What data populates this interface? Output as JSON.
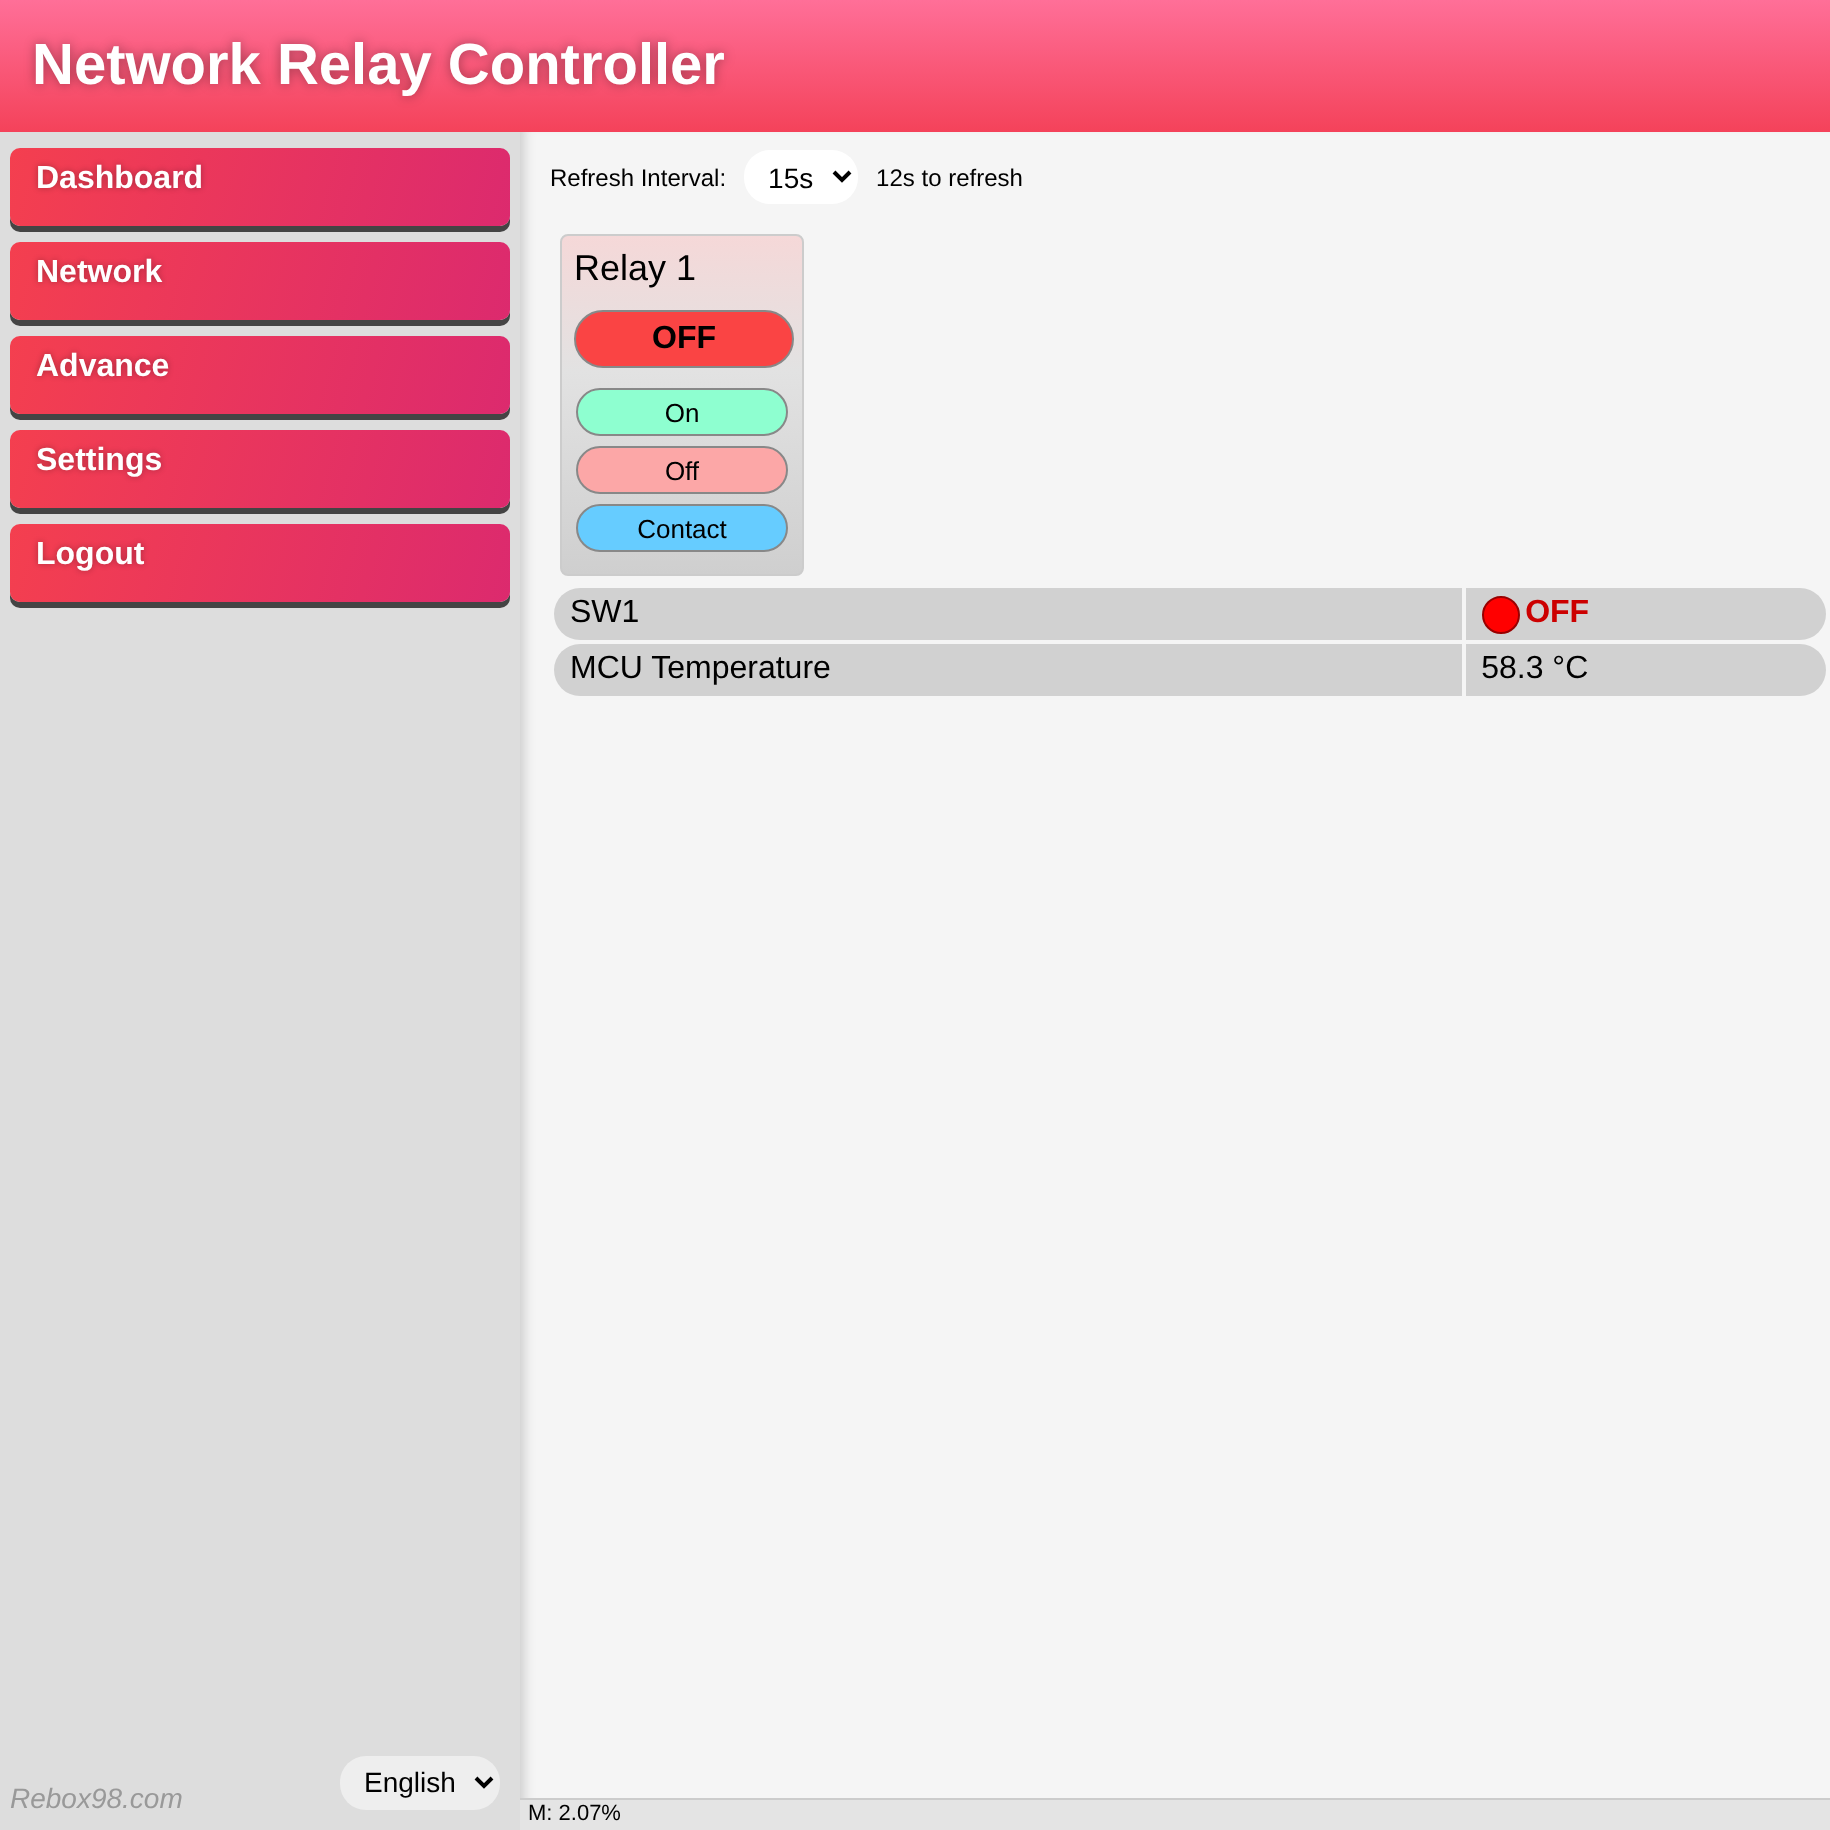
{
  "header": {
    "title": "Network Relay Controller"
  },
  "sidebar": {
    "items": [
      {
        "label": "Dashboard"
      },
      {
        "label": "Network"
      },
      {
        "label": "Advance"
      },
      {
        "label": "Settings"
      },
      {
        "label": "Logout"
      }
    ],
    "footer_text": "Rebox98.com",
    "language": "English"
  },
  "toolbar": {
    "refresh_label": "Refresh Interval:",
    "refresh_value": "15s",
    "countdown": "12s to refresh"
  },
  "relays": [
    {
      "name": "Relay 1",
      "state": "OFF",
      "on": false,
      "buttons": [
        {
          "label": "On",
          "kind": "on"
        },
        {
          "label": "Off",
          "kind": "off"
        },
        {
          "label": "Contact",
          "kind": "contact"
        }
      ]
    }
  ],
  "sensors": [
    {
      "name": "SW1",
      "kind": "switch",
      "on": false,
      "value": "OFF"
    },
    {
      "name": "MCU Temperature",
      "kind": "text",
      "value": "58.3 °C"
    }
  ],
  "status_bar": {
    "text": "M: 2.07%"
  }
}
